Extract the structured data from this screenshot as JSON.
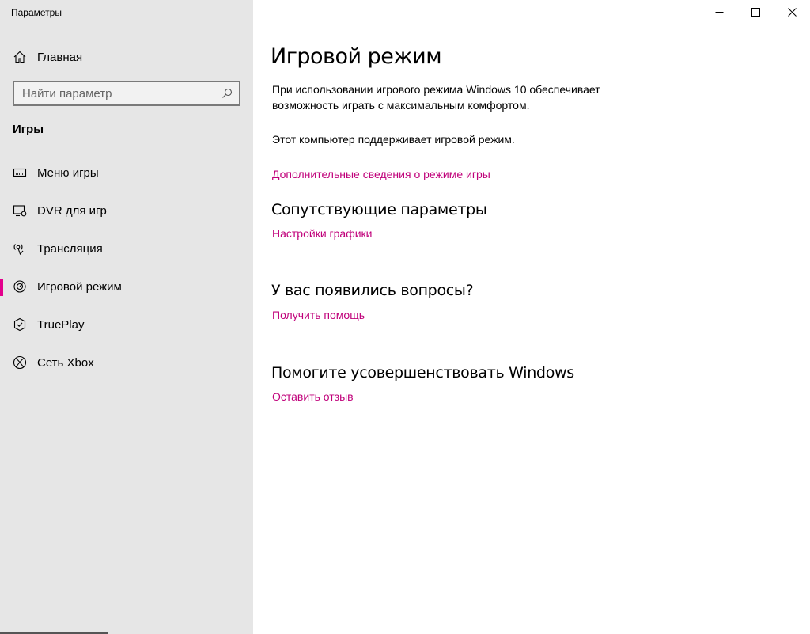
{
  "window": {
    "title": "Параметры"
  },
  "sidebar": {
    "home_label": "Главная",
    "search": {
      "placeholder": "Найти параметр",
      "value": ""
    },
    "section_heading": "Игры",
    "items": [
      {
        "label": "Меню игры",
        "icon": "game-bar-icon",
        "active": false
      },
      {
        "label": "DVR для игр",
        "icon": "game-dvr-icon",
        "active": false
      },
      {
        "label": "Трансляция",
        "icon": "broadcast-icon",
        "active": false
      },
      {
        "label": "Игровой режим",
        "icon": "game-mode-icon",
        "active": true
      },
      {
        "label": "TruePlay",
        "icon": "trueplay-icon",
        "active": false
      },
      {
        "label": "Сеть Xbox",
        "icon": "xbox-icon",
        "active": false
      }
    ]
  },
  "main": {
    "title": "Игровой режим",
    "description_line1": "При использовании игрового режима Windows 10 обеспечивает",
    "description_line2": "возможность играть с максимальным комфортом.",
    "support_text": "Этот компьютер поддерживает игровой режим.",
    "more_info_link": "Дополнительные сведения о режиме игры",
    "related_heading": "Сопутствующие параметры",
    "graphics_link": "Настройки графики",
    "questions_heading": "У вас появились вопросы?",
    "help_link": "Получить помощь",
    "improve_heading": "Помогите усовершенствовать Windows",
    "feedback_link": "Оставить отзыв"
  },
  "colors": {
    "accent": "#e3008c",
    "link": "#c0007a",
    "sidebar_bg": "#e6e6e6"
  }
}
